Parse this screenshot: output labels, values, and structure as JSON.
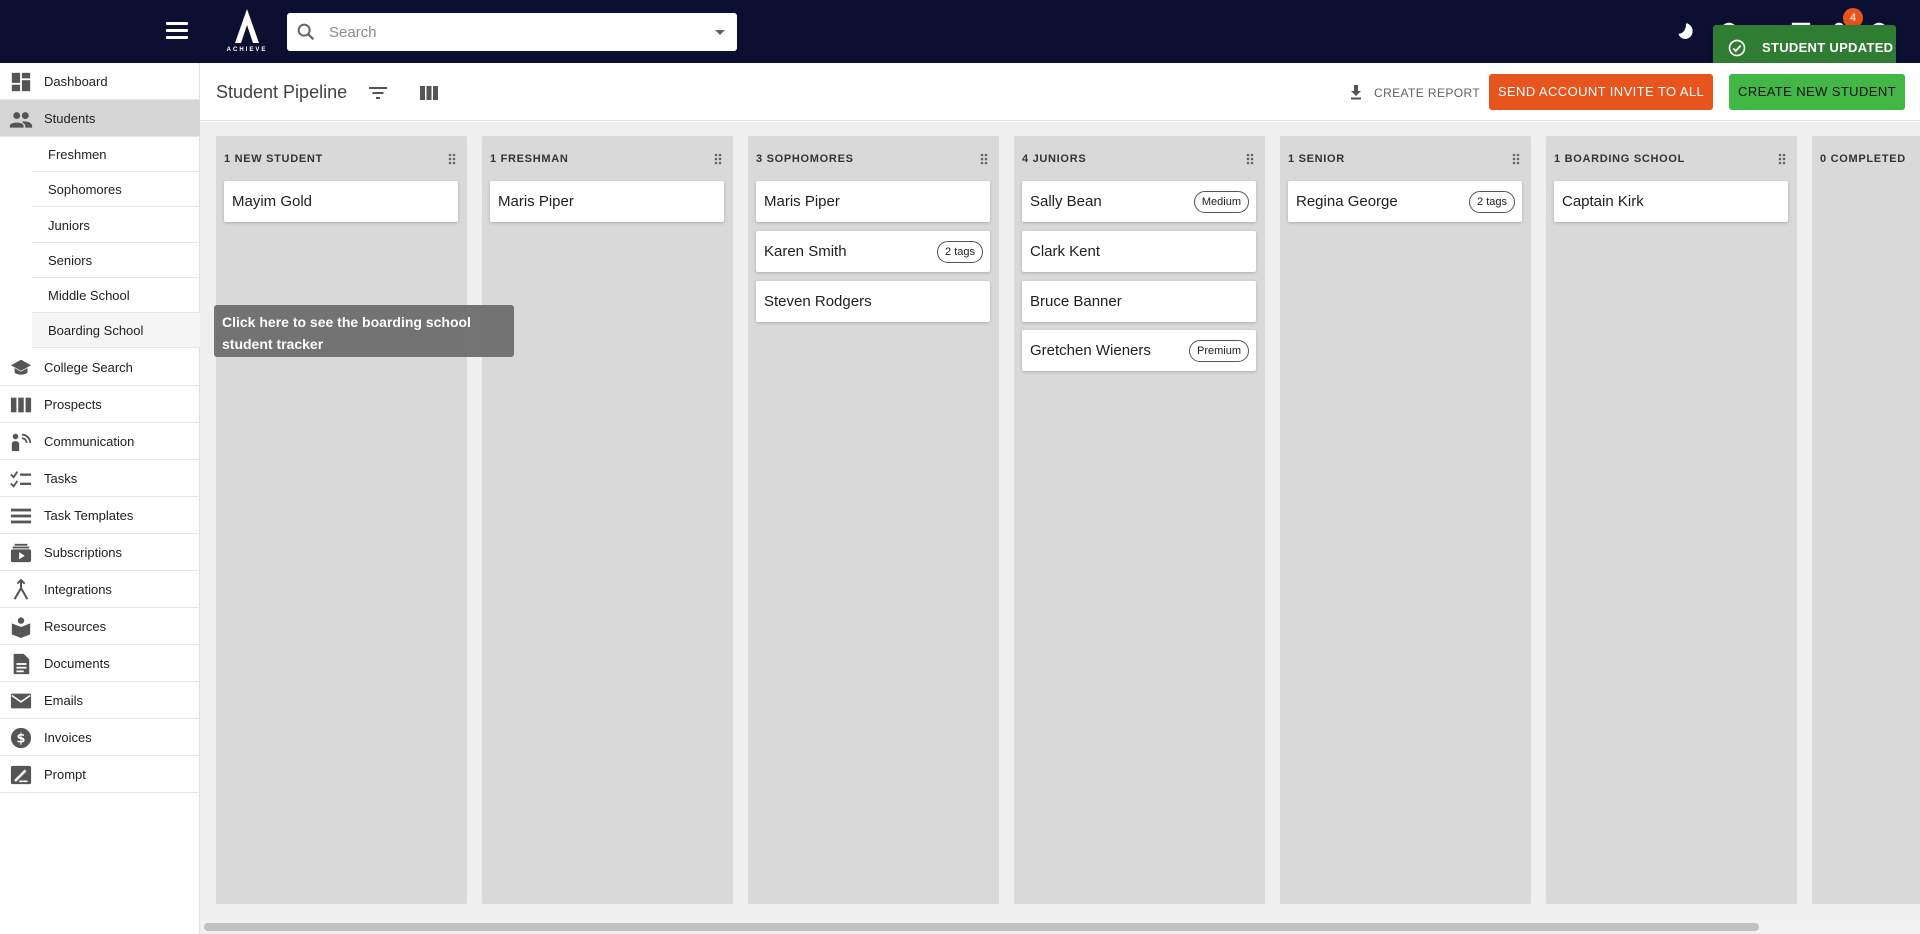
{
  "app": {
    "logo_text": "ACHIEVE"
  },
  "search": {
    "placeholder": "Search"
  },
  "notifications": {
    "count": "4"
  },
  "toast": {
    "text": "STUDENT UPDATED",
    "color": "#2e7d32"
  },
  "sidebar": {
    "items": [
      {
        "label": "Dashboard",
        "icon": "dashboard-icon"
      },
      {
        "label": "Students",
        "icon": "people-icon",
        "active": true
      },
      {
        "label": "College Search",
        "icon": "school-icon"
      },
      {
        "label": "Prospects",
        "icon": "columns-icon"
      },
      {
        "label": "Communication",
        "icon": "communication-icon"
      },
      {
        "label": "Tasks",
        "icon": "checklist-icon"
      },
      {
        "label": "Task Templates",
        "icon": "list-icon"
      },
      {
        "label": "Subscriptions",
        "icon": "subscriptions-icon"
      },
      {
        "label": "Integrations",
        "icon": "merge-icon"
      },
      {
        "label": "Resources",
        "icon": "book-icon"
      },
      {
        "label": "Documents",
        "icon": "document-icon"
      },
      {
        "label": "Emails",
        "icon": "mail-icon"
      },
      {
        "label": "Invoices",
        "icon": "dollar-icon"
      },
      {
        "label": "Prompt",
        "icon": "draw-icon"
      }
    ],
    "sub_items": [
      "Freshmen",
      "Sophomores",
      "Juniors",
      "Seniors",
      "Middle School",
      "Boarding School"
    ]
  },
  "header": {
    "title": "Student Pipeline",
    "report_label": "CREATE REPORT",
    "invite_label": "SEND ACCOUNT INVITE TO ALL",
    "create_label": "CREATE NEW STUDENT",
    "invite_color": "#e8541d",
    "create_color": "#43b746"
  },
  "board": {
    "columns": [
      {
        "title": "1 NEW STUDENT",
        "cards": [
          {
            "name": "Mayim Gold",
            "tag": ""
          }
        ]
      },
      {
        "title": "1 FRESHMAN",
        "cards": [
          {
            "name": "Maris Piper",
            "tag": ""
          }
        ]
      },
      {
        "title": "3 SOPHOMORES",
        "cards": [
          {
            "name": "Maris Piper",
            "tag": ""
          },
          {
            "name": "Karen Smith",
            "tag": "2 tags"
          },
          {
            "name": "Steven Rodgers",
            "tag": ""
          }
        ]
      },
      {
        "title": "4 JUNIORS",
        "cards": [
          {
            "name": "Sally Bean",
            "tag": "Medium"
          },
          {
            "name": "Clark Kent",
            "tag": ""
          },
          {
            "name": "Bruce Banner",
            "tag": ""
          },
          {
            "name": "Gretchen Wieners",
            "tag": "Premium"
          }
        ]
      },
      {
        "title": "1 SENIOR",
        "cards": [
          {
            "name": "Regina George",
            "tag": "2 tags"
          }
        ]
      },
      {
        "title": "1 BOARDING SCHOOL",
        "cards": [
          {
            "name": "Captain Kirk",
            "tag": ""
          }
        ]
      },
      {
        "title": "0 COMPLETED",
        "cards": []
      }
    ]
  },
  "tooltip": {
    "text": "Click here to see the boarding school student tracker"
  }
}
